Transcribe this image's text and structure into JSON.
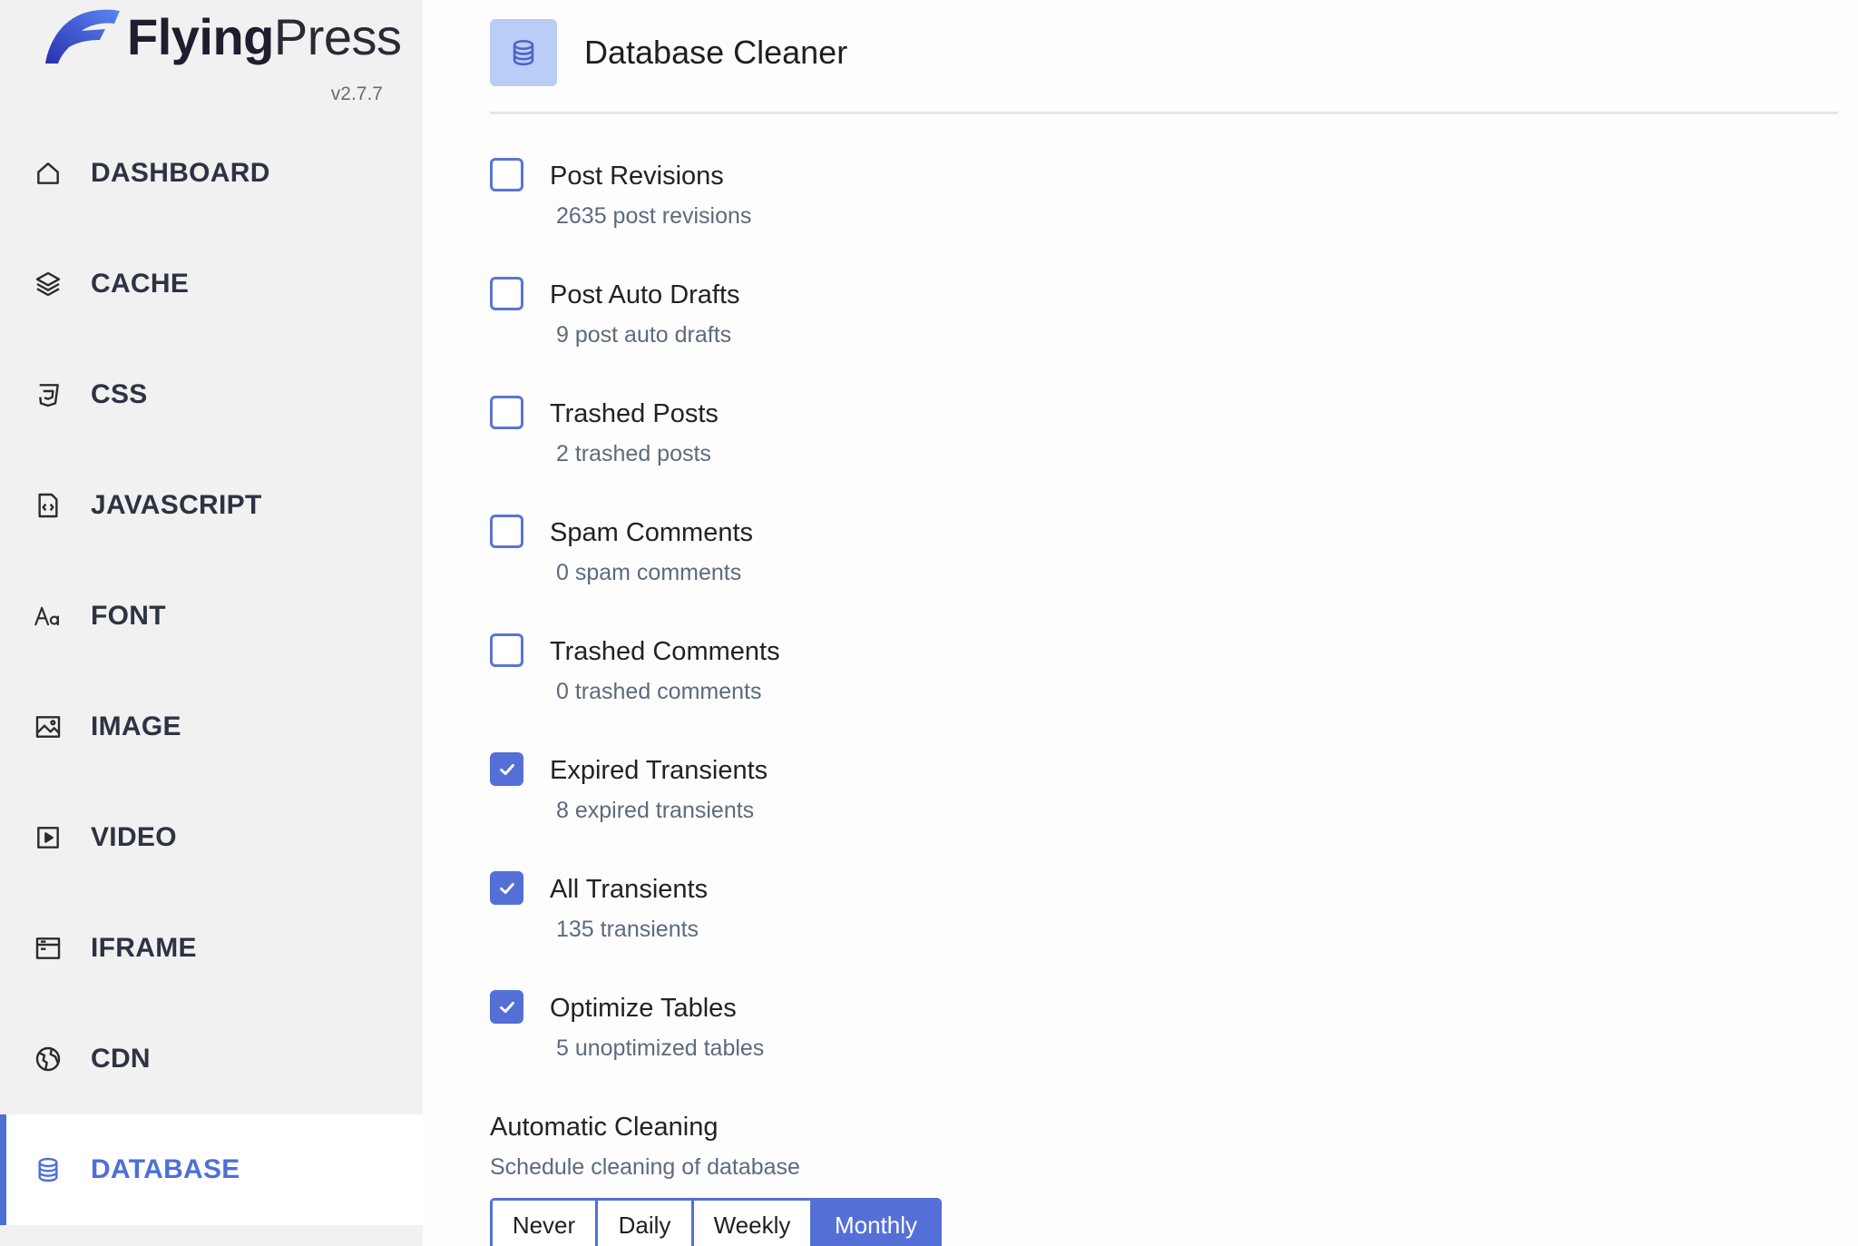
{
  "brand": {
    "name_bold": "Flying",
    "name_light": "Press",
    "version": "v2.7.7",
    "accent": "#4e6fd8"
  },
  "sidebar": {
    "items": [
      {
        "label": "DASHBOARD",
        "icon": "home-icon"
      },
      {
        "label": "CACHE",
        "icon": "layers-icon"
      },
      {
        "label": "CSS",
        "icon": "css-icon"
      },
      {
        "label": "JAVASCRIPT",
        "icon": "code-file-icon"
      },
      {
        "label": "FONT",
        "icon": "font-icon"
      },
      {
        "label": "IMAGE",
        "icon": "image-icon"
      },
      {
        "label": "VIDEO",
        "icon": "video-icon"
      },
      {
        "label": "IFRAME",
        "icon": "browser-window-icon"
      },
      {
        "label": "CDN",
        "icon": "globe-icon"
      },
      {
        "label": "DATABASE",
        "icon": "database-icon",
        "active": true
      }
    ]
  },
  "page": {
    "title": "Database Cleaner"
  },
  "options": [
    {
      "label": "Post Revisions",
      "detail": "2635 post revisions",
      "checked": false
    },
    {
      "label": "Post Auto Drafts",
      "detail": "9 post auto drafts",
      "checked": false
    },
    {
      "label": "Trashed Posts",
      "detail": "2 trashed posts",
      "checked": false
    },
    {
      "label": "Spam Comments",
      "detail": "0 spam comments",
      "checked": false
    },
    {
      "label": "Trashed Comments",
      "detail": "0 trashed comments",
      "checked": false
    },
    {
      "label": "Expired Transients",
      "detail": "8 expired transients",
      "checked": true
    },
    {
      "label": "All Transients",
      "detail": "135 transients",
      "checked": true
    },
    {
      "label": "Optimize Tables",
      "detail": "5 unoptimized tables",
      "checked": true
    }
  ],
  "automatic": {
    "title": "Automatic Cleaning",
    "subtitle": "Schedule cleaning of database",
    "choices": [
      "Never",
      "Daily",
      "Weekly",
      "Monthly"
    ],
    "selected": "Monthly"
  }
}
